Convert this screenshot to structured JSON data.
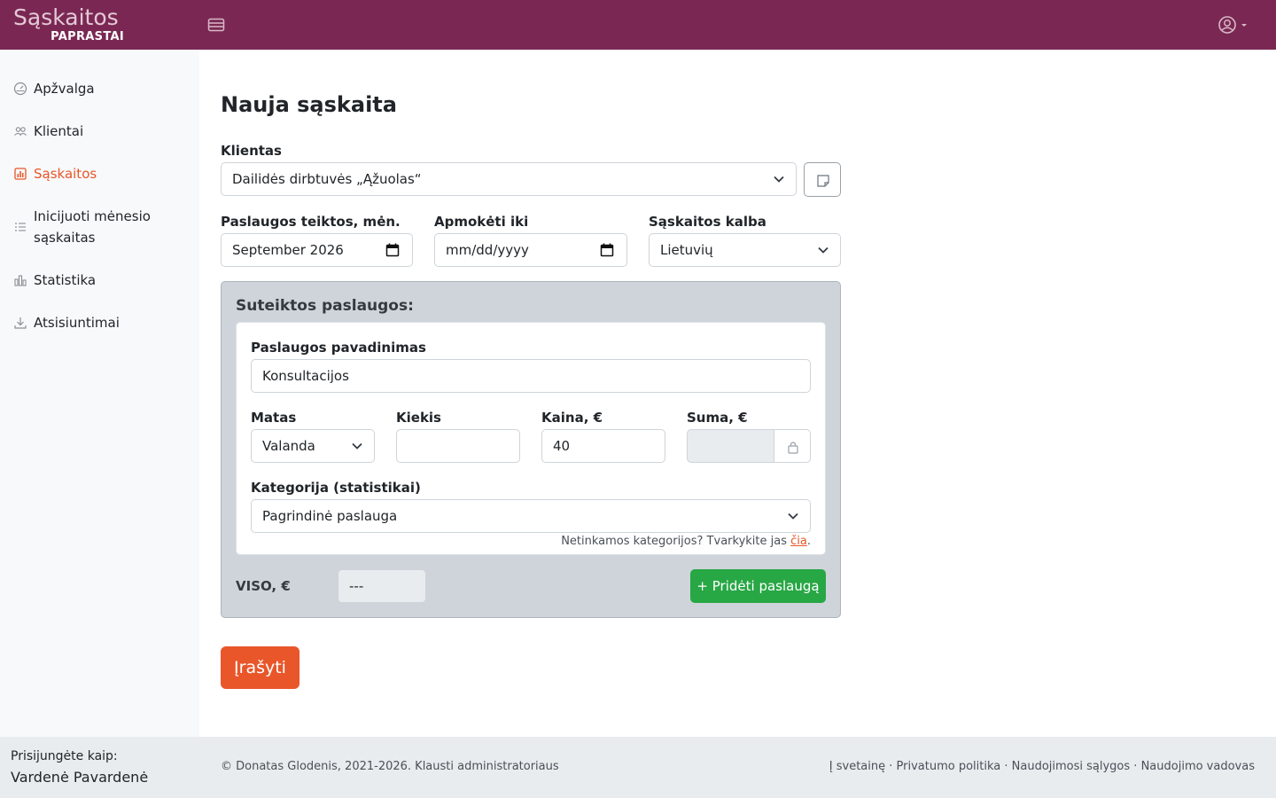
{
  "brand": {
    "name": "Sąskaitos",
    "tagline": "PAPRASTAI"
  },
  "sidebar": {
    "items": [
      {
        "label": "Apžvalga",
        "icon": "dashboard-icon",
        "active": false
      },
      {
        "label": "Klientai",
        "icon": "users-icon",
        "active": false
      },
      {
        "label": "Sąskaitos",
        "icon": "invoice-chart-icon",
        "active": true
      },
      {
        "label": "Inicijuoti mėnesio sąskaitas",
        "icon": "list-icon",
        "active": false
      },
      {
        "label": "Statistika",
        "icon": "statistics-icon",
        "active": false
      },
      {
        "label": "Atsisiuntimai",
        "icon": "download-icon",
        "active": false
      }
    ]
  },
  "form": {
    "title": "Nauja sąskaita",
    "client_label": "Klientas",
    "client_value": "Dailidės dirbtuvės „Ąžuolas“",
    "service_month_label": "Paslaugos teiktos, mėn.",
    "service_month_value": "September 2026",
    "due_label": "Apmokėti iki",
    "due_value": "mm/dd/yyyy",
    "language_label": "Sąskaitos kalba",
    "language_value": "Lietuvių",
    "services_title": "Suteiktos paslaugos:",
    "service": {
      "name_label": "Paslaugos pavadinimas",
      "name_value": "Konsultacijos",
      "unit_label": "Matas",
      "unit_value": "Valanda",
      "qty_label": "Kiekis",
      "qty_value": "",
      "price_label": "Kaina, €",
      "price_value": "40",
      "sum_label": "Suma, €",
      "sum_value": "",
      "category_label": "Kategorija (statistikai)",
      "category_value": "Pagrindinė paslauga",
      "help_text": "Netinkamos kategorijos? Tvarkykite jas ",
      "help_link": "čia",
      "help_end": "."
    },
    "total_label": "VISO, €",
    "total_value": "---",
    "add_service_label": "+ Pridėti paslaugą",
    "save_label": "Įrašyti"
  },
  "footer": {
    "logged_in_label": "Prisijungėte kaip:",
    "user_name": "Vardenė Pavardenė",
    "copyright": "© Donatas Glodenis, 2021-2026. ",
    "contact_link": "Klausti administratoriaus",
    "links": [
      "Į svetainę",
      "Privatumo politika",
      "Naudojimosi sąlygos",
      "Naudojimo vadovas"
    ],
    "separator": " · "
  },
  "colors": {
    "topbar": "#7a2853",
    "accent": "#e8562a",
    "success": "#28a745",
    "panel": "#ced4da"
  }
}
